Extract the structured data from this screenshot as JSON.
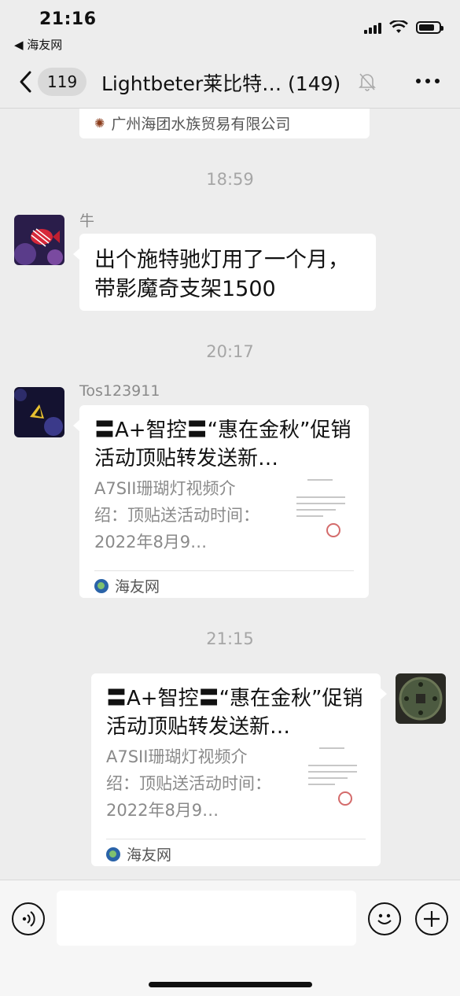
{
  "status_bar": {
    "time": "21:16",
    "back_app": "◀ 海友网"
  },
  "nav": {
    "unread_count": "119",
    "title": "Lightbeter莱比特… (149)"
  },
  "messages": {
    "partial": {
      "source": "广州海团水族贸易有限公司"
    },
    "ts1": "18:59",
    "msg1": {
      "sender": "牛",
      "text": "出个施特驰灯用了一个月，带影魔奇支架1500"
    },
    "ts2": "20:17",
    "msg2": {
      "sender": "Tos123911",
      "card_title": "〓A+智控〓“惠在金秋”促销活动顶贴转发送新…",
      "card_desc": "A7SII珊瑚灯视频介绍：顶贴送活动时间：2022年8月9…",
      "card_source": "海友网"
    },
    "ts3": "21:15",
    "msg3": {
      "card_title": "〓A+智控〓“惠在金秋”促销活动顶贴转发送新…",
      "card_desc": "A7SII珊瑚灯视频介绍：顶贴送活动时间：2022年8月9…",
      "card_source": "海友网"
    }
  },
  "input": {
    "placeholder": ""
  },
  "colors": {
    "background": "#ededed",
    "bubble": "#ffffff",
    "timestamp": "#a6a6a6"
  }
}
